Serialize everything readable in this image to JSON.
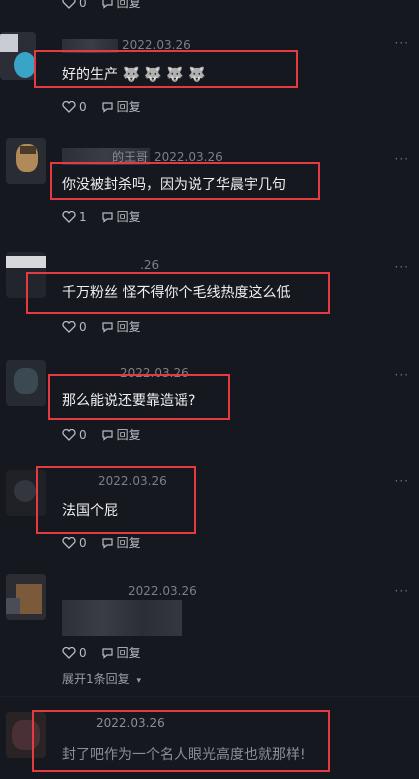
{
  "comments": [
    {
      "name": "",
      "date": "2022.03.26",
      "text": "好的生产 🐺 🐺 🐺 🐺",
      "likes": "0",
      "reply_label": "回复"
    },
    {
      "name": "的王哥",
      "date": "2022.03.26",
      "text": "你没被封杀吗，因为说了华晨宇几句",
      "likes": "1",
      "reply_label": "回复"
    },
    {
      "name": "",
      "date": ".26",
      "text": "千万粉丝 怪不得你个毛线热度这么低",
      "likes": "0",
      "reply_label": "回复"
    },
    {
      "name": "",
      "date": "2022.03.26",
      "text": "那么能说还要靠造谣?",
      "likes": "0",
      "reply_label": "回复"
    },
    {
      "name": "",
      "date": "2022.03.26",
      "text": "法国个屁",
      "likes": "0",
      "reply_label": "回复"
    },
    {
      "name": "",
      "date": "2022.03.26",
      "text": "",
      "likes": "0",
      "reply_label": "回复",
      "expand_label": "展开1条回复"
    },
    {
      "name": "",
      "date": "2022.03.26",
      "text": "封了吧作为一个名人眼光高度也就那样!"
    }
  ],
  "top_partial": {
    "likes": "0",
    "reply_label": "回复"
  },
  "more_label": "···",
  "colors": {
    "highlight": "#e43b43",
    "background": "#16181f"
  }
}
